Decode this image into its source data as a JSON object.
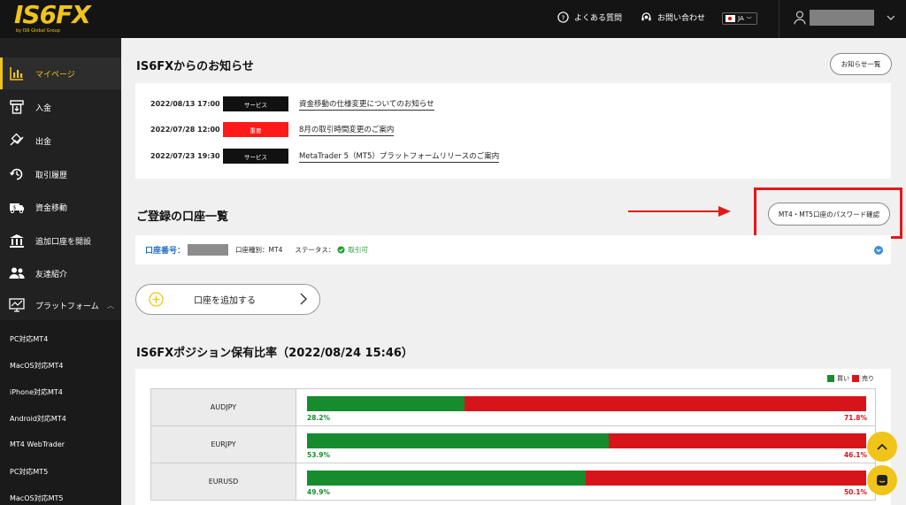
{
  "header": {
    "logo_text": "IS6FX",
    "logo_sub": "by IS6 Global Group",
    "faq": "よくある質問",
    "contact": "お問い合わせ",
    "lang": "JA"
  },
  "sidebar": {
    "items": [
      {
        "label": "マイページ",
        "icon": "chart-bar-icon"
      },
      {
        "label": "入金",
        "icon": "deposit-icon"
      },
      {
        "label": "出金",
        "icon": "withdraw-icon"
      },
      {
        "label": "取引履歴",
        "icon": "history-icon"
      },
      {
        "label": "資金移動",
        "icon": "transfer-icon"
      },
      {
        "label": "追加口座を開設",
        "icon": "bank-icon"
      },
      {
        "label": "友達紹介",
        "icon": "friends-icon"
      },
      {
        "label": "プラットフォーム",
        "icon": "monitor-chart-icon"
      }
    ],
    "sub_items": [
      "PC対応MT4",
      "MacOS対応MT4",
      "iPhone対応MT4",
      "Android対応MT4",
      "MT4 WebTrader",
      "PC対応MT5",
      "MacOS対応MT5"
    ]
  },
  "news": {
    "title": "IS6FXからのお知らせ",
    "list_button": "お知らせ一覧",
    "items": [
      {
        "date": "2022/08/13 17:00",
        "tag": "サービス",
        "tag_color": "#111111",
        "title": "資金移動の仕様変更についてのお知らせ"
      },
      {
        "date": "2022/07/28 12:00",
        "tag": "重要",
        "tag_color": "#ff1a1a",
        "title": "8月の取引時間変更のご案内"
      },
      {
        "date": "2022/07/23 19:30",
        "tag": "サービス",
        "tag_color": "#111111",
        "title": "MetaTrader 5（MT5）プラットフォームリリースのご案内"
      }
    ]
  },
  "accounts": {
    "title": "ご登録の口座一覧",
    "password_button": "MT4・MT5口座のパスワード確認",
    "account_label": "口座番号：",
    "type_text": "口座種別：MT4",
    "status_label": "ステータス：",
    "status_value": "取引可",
    "add_button": "口座を追加する"
  },
  "positions": {
    "title": "IS6FXポジション保有比率（2022/08/24 15:46）",
    "legend_buy": "買い",
    "legend_sell": "売り",
    "buy_color": "#178c2e",
    "sell_color": "#d8141b",
    "rows": [
      {
        "pair": "AUDJPY",
        "buy": 28.2,
        "buy_text": "28.2%",
        "sell_text": "71.8%"
      },
      {
        "pair": "EURJPY",
        "buy": 53.9,
        "buy_text": "53.9%",
        "sell_text": "46.1%"
      },
      {
        "pair": "EURUSD",
        "buy": 49.9,
        "buy_text": "49.9%",
        "sell_text": "50.1%"
      }
    ]
  }
}
